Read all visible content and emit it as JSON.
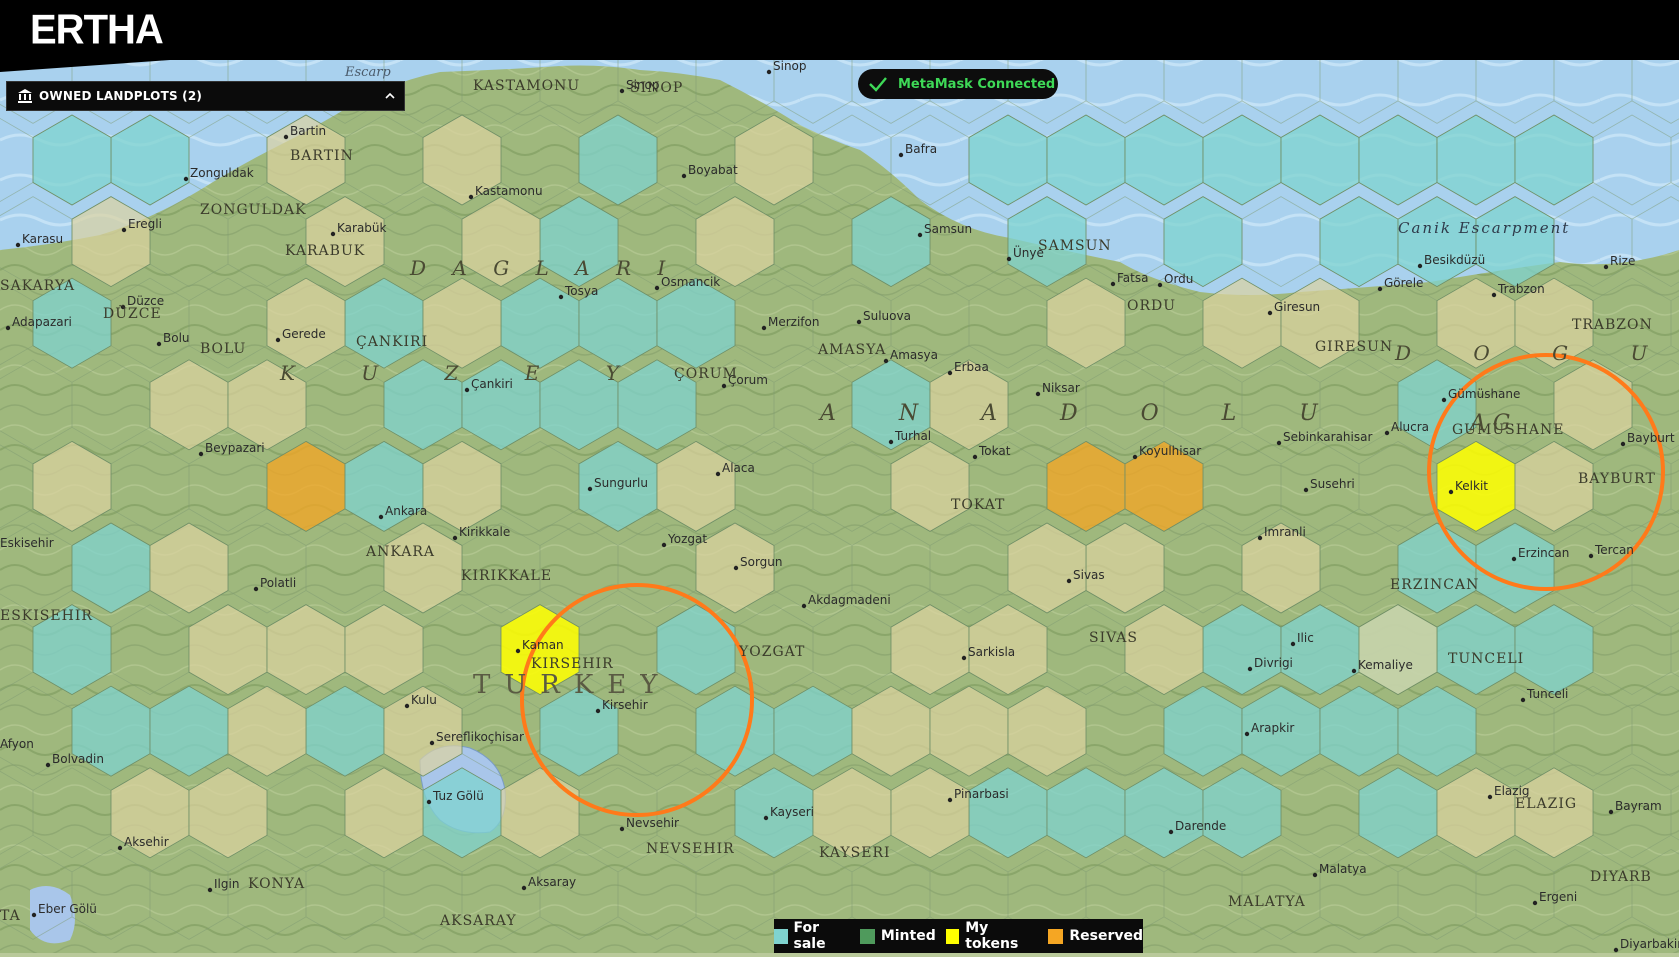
{
  "app": {
    "title": "ERTHA"
  },
  "owned_panel": {
    "title": "OWNED LANDPLOTS (2)",
    "icon": "bank-icon",
    "chevron": "chevron-up-icon"
  },
  "wallet": {
    "status": "MetaMask Connected",
    "icon": "check-icon",
    "color": "#3ed957"
  },
  "legend": [
    {
      "label": "For sale",
      "color": "#7fd3cf"
    },
    {
      "label": "Minted",
      "color": "#4f9a5c"
    },
    {
      "label": "My tokens",
      "color": "#ffff00"
    },
    {
      "label": "Reserved",
      "color": "#f5a623"
    }
  ],
  "map": {
    "towns": [
      "Bartin",
      "Zonguldak",
      "Kastamonu",
      "Sinop",
      "Boyabat",
      "Bafra",
      "Sinop",
      "Karabük",
      "Eregli",
      "Karasu",
      "Düzce",
      "Adapazari",
      "Bolu",
      "Gerede",
      "Tosya",
      "Osmancik",
      "Samsun",
      "Ünye",
      "Fatsa",
      "Ordu",
      "Giresun",
      "Besikdüzü",
      "Görele",
      "Trabzon",
      "Rize",
      "Merzifon",
      "Suluova",
      "Amasya",
      "Çorum",
      "Çankiri",
      "Erbaa",
      "Niksar",
      "Turhal",
      "Tokat",
      "Koyulhisar",
      "Sebinkarahisar",
      "Alucra",
      "Gümüshane",
      "Bayburt",
      "Kelkit",
      "Susehri",
      "Erzincan",
      "Tercan",
      "Imranli",
      "Beypazari",
      "Ankara",
      "Kirikkale",
      "Sungurlu",
      "Alaca",
      "Yozgat",
      "Sorgun",
      "Akdagmadeni",
      "Polatli",
      "Kaman",
      "Kirsehir",
      "Kulu",
      "Sereflikoçhisar",
      "Nevsehir",
      "Aksaray",
      "Kayseri",
      "Sarkisla",
      "Sivas",
      "Divrigi",
      "Ilic",
      "Kemaliye",
      "Pinarbasi",
      "Darende",
      "Arapkir",
      "Malatya",
      "Elazig",
      "Tunceli",
      "Ergeni",
      "Tuz Gölü",
      "Afyon",
      "Bolvadin",
      "Aksehir",
      "Ilgin",
      "Eskisehir",
      "Eber Gölü",
      "Bayram",
      "Diyarbakir"
    ],
    "provinces": [
      "BARTIN",
      "ZONGULDAK",
      "KASTAMONU",
      "SINOP",
      "KARABUK",
      "DÜZCE",
      "BOLU",
      "ÇANKIRI",
      "SAKARYA",
      "SAMSUN",
      "ORDU",
      "GIRESUN",
      "TRABZON",
      "AMASYA",
      "ÇORUM",
      "TOKAT",
      "GUMUSHANE",
      "BAYBURT",
      "ERZINCAN",
      "ANKARA",
      "KIRIKKALE",
      "YOZGAT",
      "KIRSEHIR",
      "NEVSEHIR",
      "KAYSERI",
      "SIVAS",
      "TUNCELI",
      "ELAZIG",
      "MALATYA",
      "KONYA",
      "AKSARAY",
      "ESKISEHIR",
      "DIYARB",
      "TA",
      "TURKEY"
    ],
    "regions": [
      "D A G L A R I",
      "K U Z E Y",
      "A N A D O L U",
      "D O G U",
      "A G",
      "Canik Escarpment",
      "Escarp"
    ]
  }
}
